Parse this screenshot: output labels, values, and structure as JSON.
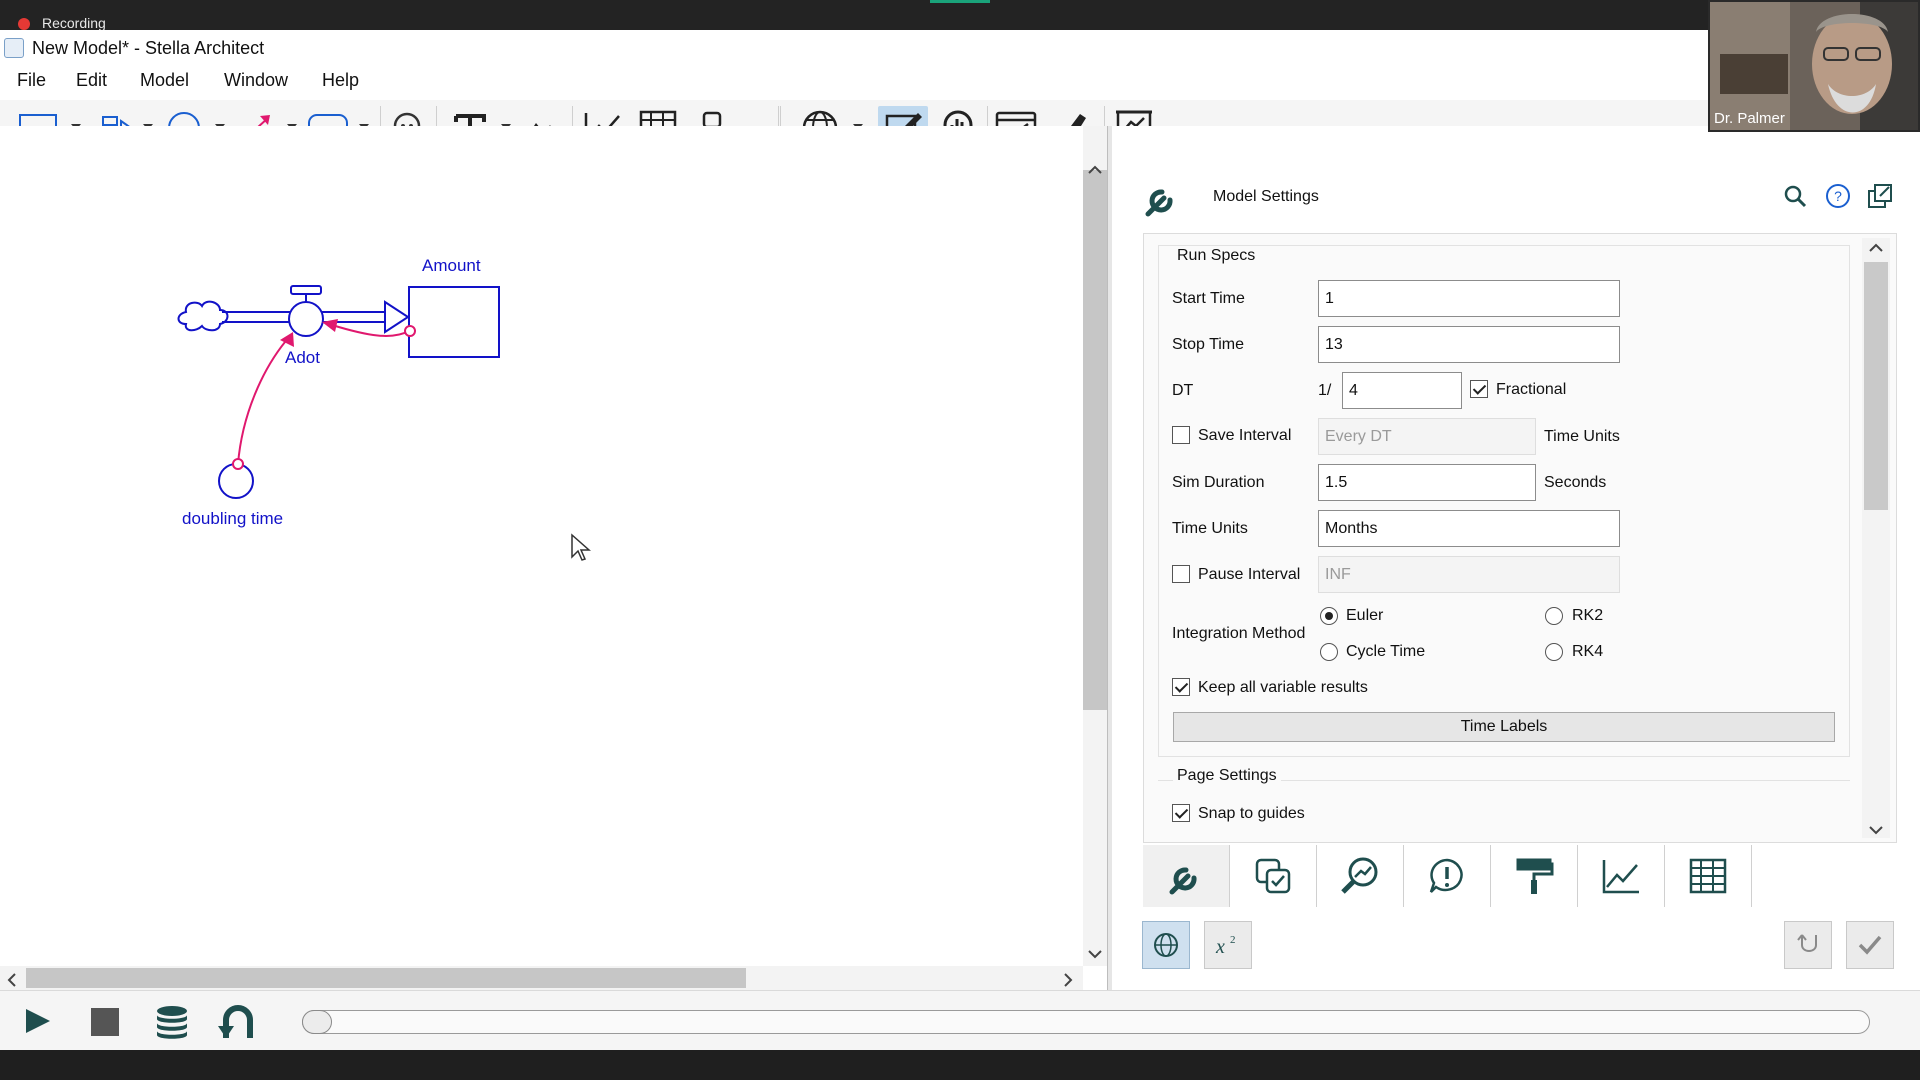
{
  "recording": {
    "label": "Recording"
  },
  "window": {
    "title": "New Model* - Stella Architect"
  },
  "menu": [
    "File",
    "Edit",
    "Model",
    "Window",
    "Help"
  ],
  "toolbar": {
    "tools": [
      "stock-tool",
      "flow-tool",
      "converter-tool",
      "connector-tool",
      "module-tool",
      "ghost-tool",
      "text-tool",
      "image-tool",
      "graph-tool",
      "table-tool",
      "numeric-display-tool",
      "globe-tool",
      "edit-mode",
      "analyze-mode",
      "dashboard-tool",
      "publish-tool",
      "presentation-tool"
    ],
    "active_mode": "edit-mode"
  },
  "diagram": {
    "stock": {
      "name": "Amount"
    },
    "flow": {
      "name": "Adot"
    },
    "converter": {
      "name": "doubling time"
    },
    "colors": {
      "element": "#1212c8",
      "connector": "#e0186e"
    }
  },
  "panel": {
    "title": "Model Settings",
    "run_specs": {
      "section_title": "Run Specs",
      "start_time": {
        "label": "Start Time",
        "value": "1"
      },
      "stop_time": {
        "label": "Stop Time",
        "value": "13"
      },
      "dt": {
        "label": "DT",
        "prefix": "1/",
        "value": "4",
        "fractional_label": "Fractional",
        "fractional_checked": true
      },
      "save_interval": {
        "label": "Save Interval",
        "checked": false,
        "value": "Every DT",
        "unit": "Time Units"
      },
      "sim_duration": {
        "label": "Sim Duration",
        "value": "1.5",
        "unit": "Seconds"
      },
      "time_units": {
        "label": "Time Units",
        "value": "Months"
      },
      "pause_interval": {
        "label": "Pause Interval",
        "checked": false,
        "value": "INF"
      },
      "integration": {
        "label": "Integration Method",
        "options": [
          "Euler",
          "RK2",
          "Cycle Time",
          "RK4"
        ],
        "selected": "Euler"
      },
      "keep_results": {
        "label": "Keep all variable results",
        "checked": true
      },
      "time_labels_button": "Time Labels"
    },
    "page_settings": {
      "section_title": "Page Settings",
      "snap_to_guides": {
        "label": "Snap to guides",
        "checked": true
      }
    },
    "tabs": [
      "model-settings",
      "checklist",
      "analyze",
      "warnings",
      "style",
      "graph",
      "table"
    ],
    "active_tab": "model-settings"
  },
  "webcam": {
    "name": "Dr. Palmer"
  }
}
